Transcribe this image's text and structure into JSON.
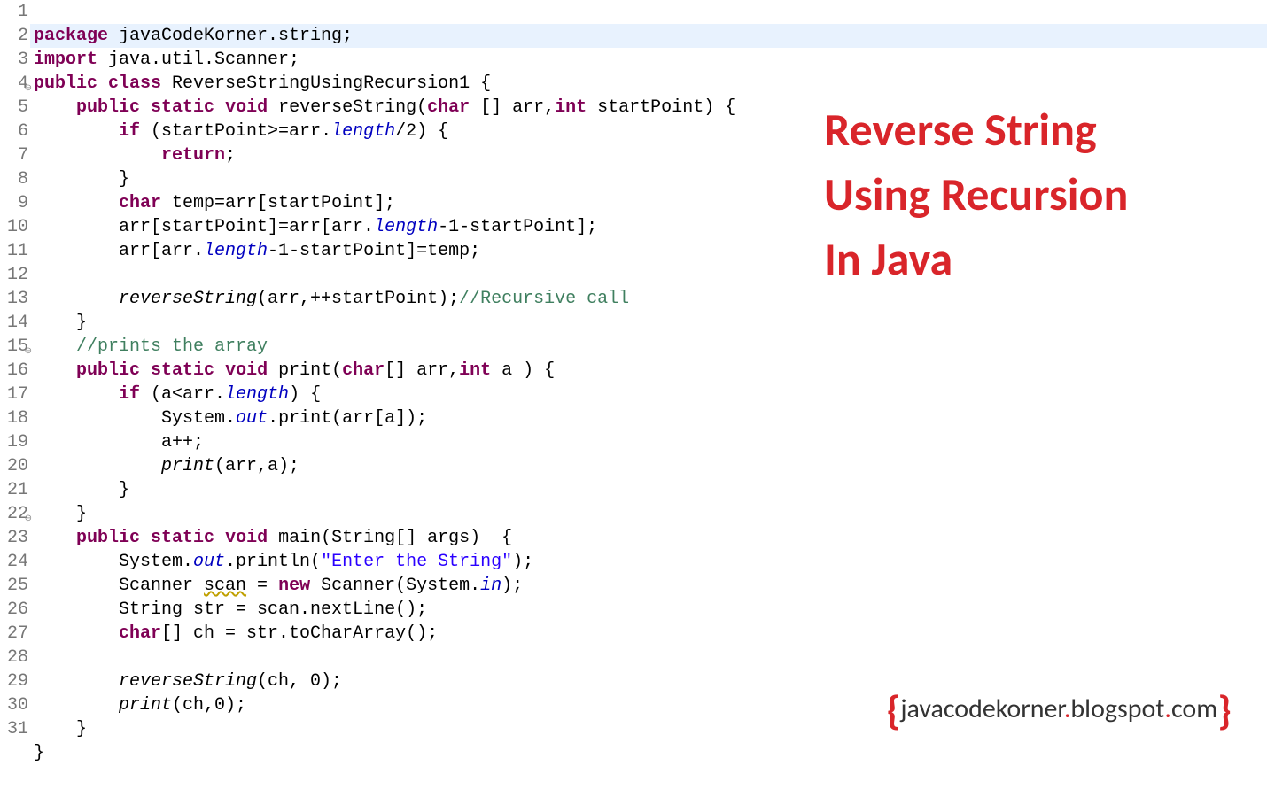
{
  "title_line1": "Reverse String",
  "title_line2": "Using Recursion",
  "title_line3": "In Java",
  "footer_brace_open": "{",
  "footer_text_a": "javacodekorner",
  "footer_dot1": ".",
  "footer_text_b": "blogspot",
  "footer_dot2": ".",
  "footer_text_c": "com",
  "footer_brace_close": "}",
  "lines": {
    "1": "1",
    "2": "2",
    "3": "3",
    "4": "4",
    "5": "5",
    "6": "6",
    "7": "7",
    "8": "8",
    "9": "9",
    "10": "10",
    "11": "11",
    "12": "12",
    "13": "13",
    "14": "14",
    "15": "15",
    "16": "16",
    "17": "17",
    "18": "18",
    "19": "19",
    "20": "20",
    "21": "21",
    "22": "22",
    "23": "23",
    "24": "24",
    "25": "25",
    "26": "26",
    "27": "27",
    "28": "28",
    "29": "29",
    "30": "30",
    "31": "31"
  },
  "tok": {
    "package": "package",
    "pkgname": " javaCodeKorner.string;",
    "import": "import",
    "importname": " java.util.Scanner;",
    "public": "public",
    "class": "class",
    "classname": " ReverseStringUsingRecursion1 {",
    "static": "static",
    "void": "void",
    "char": "char",
    "int": "int",
    "new": "new",
    "reverseStringSig": " reverseString(",
    "arrParam": " [] arr,",
    "startPointParam": " startPoint) {",
    "if": "if",
    "ifCond1": " (startPoint>=arr.",
    "length": "length",
    "div2": "/2) {",
    "return": "return",
    "semicolon": ";",
    "closeBrace": "}",
    "tempDecl": " temp=arr[startPoint];",
    "swap1a": "arr[startPoint]=arr[arr.",
    "swap1b": "-1-startPoint];",
    "swap2a": "arr[arr.",
    "swap2b": "-1-startPoint]=temp;",
    "recCallA": "reverseString",
    "recCallB": "(arr,++startPoint);",
    "recComment": "//Recursive call",
    "printsComment": "//prints the array",
    "printSigA": " print(",
    "arrParam2": "[] arr,",
    "aParam": " a ) {",
    "ifCond2": " (a<arr.",
    "closeParenBrace": ") {",
    "sysout": "System.",
    "out": "out",
    "dotPrint": ".print(arr[a]);",
    "ainc": "a++;",
    "printCallA": "print",
    "printCallB": "(arr,a);",
    "mainSig": " main(String[] args)  {",
    "println": ".println(",
    "enterStr": "\"Enter the String\"",
    "closeParenSemi": ");",
    "scannerDecl": "Scanner ",
    "scanVar": "scan",
    " eq ": " = ",
    "scannerNew": " Scanner(System.",
    "in": "in",
    "closeNew": ");",
    "stringDecl": "String str = scan.nextLine();",
    "charArr": "[] ch = str.toCharArray();",
    "revCall2": "(ch, 0);",
    "printCall2": "(ch,0);",
    "sp4": "    ",
    "sp8": "        ",
    "sp12": "            ",
    "sp16": "                "
  }
}
